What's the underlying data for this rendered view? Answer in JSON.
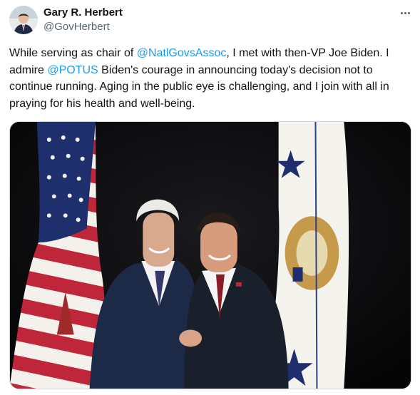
{
  "author": {
    "name": "Gary R. Herbert",
    "handle": "@GovHerbert",
    "avatar_icon": "person-in-suit-avatar"
  },
  "menu": {
    "icon": "more-options-icon"
  },
  "tweet": {
    "parts": {
      "t1": "While serving as chair of ",
      "m1": "@NatlGovsAssoc",
      "t2": ", I met with then-VP Joe Biden. I admire ",
      "m2": "@POTUS",
      "t3": " Biden's courage in announcing today's decision not to continue running. Aging in the public eye is challenging, and I join with all in praying for his health and well-being."
    },
    "link_color": "#1d9bf0"
  },
  "media": {
    "icon": "photo-two-men-handshake-flags"
  }
}
